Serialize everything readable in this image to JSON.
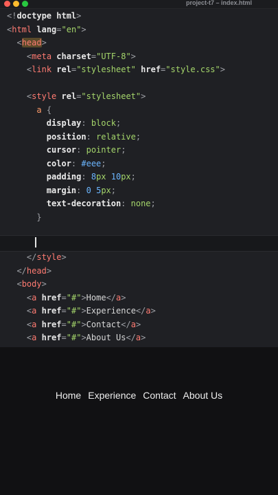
{
  "window": {
    "title": "project-t7 – index.html",
    "traffic_lights": [
      {
        "name": "close",
        "color": "#ff5f57"
      },
      {
        "name": "minimize",
        "color": "#febc2e"
      },
      {
        "name": "zoom",
        "color": "#28c840"
      }
    ]
  },
  "editor": {
    "lines": [
      [
        {
          "t": "punct",
          "v": "<!"
        },
        {
          "t": "doctype",
          "v": "doctype html"
        },
        {
          "t": "punct",
          "v": ">"
        }
      ],
      [
        {
          "t": "punct",
          "v": "<"
        },
        {
          "t": "tag",
          "v": "html"
        },
        {
          "t": "text",
          "v": " "
        },
        {
          "t": "attr",
          "v": "lang"
        },
        {
          "t": "punct",
          "v": "="
        },
        {
          "t": "string",
          "v": "\"en\""
        },
        {
          "t": "punct",
          "v": ">"
        }
      ],
      [
        {
          "t": "text",
          "v": "  "
        },
        {
          "t": "punct",
          "v": "<"
        },
        {
          "t": "tag",
          "v": "head",
          "hl": true
        },
        {
          "t": "punct",
          "v": ">"
        }
      ],
      [
        {
          "t": "text",
          "v": "    "
        },
        {
          "t": "punct",
          "v": "<"
        },
        {
          "t": "tag",
          "v": "meta"
        },
        {
          "t": "text",
          "v": " "
        },
        {
          "t": "attr",
          "v": "charset"
        },
        {
          "t": "punct",
          "v": "="
        },
        {
          "t": "string",
          "v": "\"UTF-8\""
        },
        {
          "t": "punct",
          "v": ">"
        }
      ],
      [
        {
          "t": "text",
          "v": "    "
        },
        {
          "t": "punct",
          "v": "<"
        },
        {
          "t": "tag",
          "v": "link"
        },
        {
          "t": "text",
          "v": " "
        },
        {
          "t": "attr",
          "v": "rel"
        },
        {
          "t": "punct",
          "v": "="
        },
        {
          "t": "string",
          "v": "\"stylesheet\""
        },
        {
          "t": "text",
          "v": " "
        },
        {
          "t": "attr",
          "v": "href"
        },
        {
          "t": "punct",
          "v": "="
        },
        {
          "t": "string",
          "v": "\"style.css\""
        },
        {
          "t": "punct",
          "v": ">"
        }
      ],
      [],
      [
        {
          "t": "text",
          "v": "    "
        },
        {
          "t": "punct",
          "v": "<"
        },
        {
          "t": "tag",
          "v": "style"
        },
        {
          "t": "text",
          "v": " "
        },
        {
          "t": "attr",
          "v": "rel"
        },
        {
          "t": "punct",
          "v": "="
        },
        {
          "t": "string",
          "v": "\"stylesheet\""
        },
        {
          "t": "punct",
          "v": ">"
        }
      ],
      [
        {
          "t": "text",
          "v": "      "
        },
        {
          "t": "sel",
          "v": "a"
        },
        {
          "t": "text",
          "v": " "
        },
        {
          "t": "punct",
          "v": "{"
        }
      ],
      [
        {
          "t": "text",
          "v": "        "
        },
        {
          "t": "prop",
          "v": "display"
        },
        {
          "t": "punct",
          "v": ": "
        },
        {
          "t": "value",
          "v": "block"
        },
        {
          "t": "punct",
          "v": ";"
        }
      ],
      [
        {
          "t": "text",
          "v": "        "
        },
        {
          "t": "prop",
          "v": "position"
        },
        {
          "t": "punct",
          "v": ": "
        },
        {
          "t": "value",
          "v": "relative"
        },
        {
          "t": "punct",
          "v": ";"
        }
      ],
      [
        {
          "t": "text",
          "v": "        "
        },
        {
          "t": "prop",
          "v": "cursor"
        },
        {
          "t": "punct",
          "v": ": "
        },
        {
          "t": "value",
          "v": "pointer"
        },
        {
          "t": "punct",
          "v": ";"
        }
      ],
      [
        {
          "t": "text",
          "v": "        "
        },
        {
          "t": "prop",
          "v": "color"
        },
        {
          "t": "punct",
          "v": ": "
        },
        {
          "t": "num",
          "v": "#eee"
        },
        {
          "t": "punct",
          "v": ";"
        }
      ],
      [
        {
          "t": "text",
          "v": "        "
        },
        {
          "t": "prop",
          "v": "padding"
        },
        {
          "t": "punct",
          "v": ": "
        },
        {
          "t": "num",
          "v": "8"
        },
        {
          "t": "value",
          "v": "px"
        },
        {
          "t": "text",
          "v": " "
        },
        {
          "t": "num",
          "v": "10"
        },
        {
          "t": "value",
          "v": "px"
        },
        {
          "t": "punct",
          "v": ";"
        }
      ],
      [
        {
          "t": "text",
          "v": "        "
        },
        {
          "t": "prop",
          "v": "margin"
        },
        {
          "t": "punct",
          "v": ": "
        },
        {
          "t": "num",
          "v": "0"
        },
        {
          "t": "text",
          "v": " "
        },
        {
          "t": "num",
          "v": "5"
        },
        {
          "t": "value",
          "v": "px"
        },
        {
          "t": "punct",
          "v": ";"
        }
      ],
      [
        {
          "t": "text",
          "v": "        "
        },
        {
          "t": "prop",
          "v": "text-decoration"
        },
        {
          "t": "punct",
          "v": ": "
        },
        {
          "t": "value",
          "v": "none"
        },
        {
          "t": "punct",
          "v": ";"
        }
      ],
      [
        {
          "t": "text",
          "v": "      "
        },
        {
          "t": "punct",
          "v": "}"
        }
      ],
      [],
      [],
      [
        {
          "t": "text",
          "v": "    "
        },
        {
          "t": "punct",
          "v": "</"
        },
        {
          "t": "tag",
          "v": "style"
        },
        {
          "t": "punct",
          "v": ">"
        }
      ],
      [
        {
          "t": "text",
          "v": "  "
        },
        {
          "t": "punct",
          "v": "</"
        },
        {
          "t": "tag",
          "v": "head"
        },
        {
          "t": "punct",
          "v": ">"
        }
      ],
      [
        {
          "t": "text",
          "v": "  "
        },
        {
          "t": "punct",
          "v": "<"
        },
        {
          "t": "tag",
          "v": "body"
        },
        {
          "t": "punct",
          "v": ">"
        }
      ],
      [
        {
          "t": "text",
          "v": "    "
        },
        {
          "t": "punct",
          "v": "<"
        },
        {
          "t": "tag",
          "v": "a"
        },
        {
          "t": "text",
          "v": " "
        },
        {
          "t": "attr",
          "v": "href"
        },
        {
          "t": "punct",
          "v": "="
        },
        {
          "t": "string",
          "v": "\"#\""
        },
        {
          "t": "punct",
          "v": ">"
        },
        {
          "t": "text",
          "v": "Home"
        },
        {
          "t": "punct",
          "v": "</"
        },
        {
          "t": "tag",
          "v": "a"
        },
        {
          "t": "punct",
          "v": ">"
        }
      ],
      [
        {
          "t": "text",
          "v": "    "
        },
        {
          "t": "punct",
          "v": "<"
        },
        {
          "t": "tag",
          "v": "a"
        },
        {
          "t": "text",
          "v": " "
        },
        {
          "t": "attr",
          "v": "href"
        },
        {
          "t": "punct",
          "v": "="
        },
        {
          "t": "string",
          "v": "\"#\""
        },
        {
          "t": "punct",
          "v": ">"
        },
        {
          "t": "text",
          "v": "Experience"
        },
        {
          "t": "punct",
          "v": "</"
        },
        {
          "t": "tag",
          "v": "a"
        },
        {
          "t": "punct",
          "v": ">"
        }
      ],
      [
        {
          "t": "text",
          "v": "    "
        },
        {
          "t": "punct",
          "v": "<"
        },
        {
          "t": "tag",
          "v": "a"
        },
        {
          "t": "text",
          "v": " "
        },
        {
          "t": "attr",
          "v": "href"
        },
        {
          "t": "punct",
          "v": "="
        },
        {
          "t": "string",
          "v": "\"#\""
        },
        {
          "t": "punct",
          "v": ">"
        },
        {
          "t": "text",
          "v": "Contact"
        },
        {
          "t": "punct",
          "v": "</"
        },
        {
          "t": "tag",
          "v": "a"
        },
        {
          "t": "punct",
          "v": ">"
        }
      ],
      [
        {
          "t": "text",
          "v": "    "
        },
        {
          "t": "punct",
          "v": "<"
        },
        {
          "t": "tag",
          "v": "a"
        },
        {
          "t": "text",
          "v": " "
        },
        {
          "t": "attr",
          "v": "href"
        },
        {
          "t": "punct",
          "v": "="
        },
        {
          "t": "string",
          "v": "\"#\""
        },
        {
          "t": "punct",
          "v": ">"
        },
        {
          "t": "text",
          "v": "About Us"
        },
        {
          "t": "punct",
          "v": "</"
        },
        {
          "t": "tag",
          "v": "a"
        },
        {
          "t": "punct",
          "v": ">"
        }
      ]
    ]
  },
  "preview": {
    "nav_links": [
      "Home",
      "Experience",
      "Contact",
      "About Us"
    ]
  }
}
